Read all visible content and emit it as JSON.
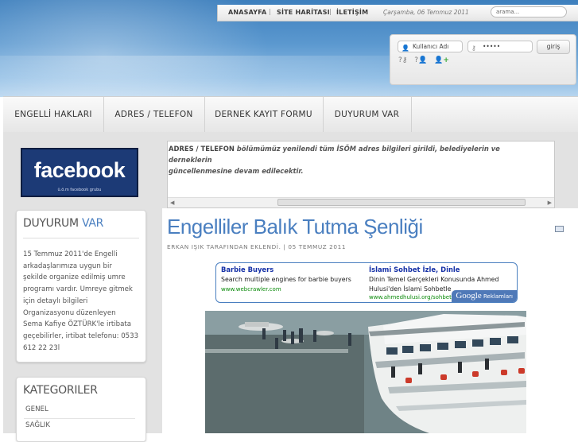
{
  "topbar": {
    "links": [
      "ANASAYFA",
      "SİTE HARİTASI",
      "İLETİŞİM"
    ],
    "separator": "|",
    "date": "Çarşamba, 06 Temmuz 2011",
    "search_placeholder": "arama..."
  },
  "login": {
    "username_placeholder": "Kullanıcı Adı",
    "password_value": "•••••",
    "button_label": "giriş"
  },
  "nav": {
    "items": [
      "ENGELLİ HAKLARI",
      "ADRES / TELEFON",
      "DERNEK KAYIT FORMU",
      "DUYURUM VAR"
    ]
  },
  "facebook": {
    "brand": "facebook",
    "caption": "ü.ö.m facebook grubu"
  },
  "sidebar": {
    "duyuru": {
      "title_a": "DUYURUM",
      "title_b": "VAR",
      "lines": [
        "15 Temmuz 2011'de Engelli",
        "arkadaşlarımıza uygun bir",
        "şekilde organize edilmiş umre",
        "programı vardır. Umreye gitmek",
        "için detaylı bilgileri",
        "Organizasyonu düzenleyen",
        "Sema Kafiye ÖZTÜRK'le irtibata",
        "geçebilirler, irtibat telefonu: 0533",
        "612 22 23l"
      ]
    },
    "kategoriler": {
      "title": "KATEGORILER",
      "items": [
        "GENEL",
        "SAĞLIK"
      ]
    }
  },
  "news": {
    "lead": "ADRES / TELEFON",
    "line1": " bölümümüz yenilendi tüm İSÖM adres bilgileri girildi, belediyelerin ve derneklerin",
    "line2": "güncellenmesine devam edilecektir."
  },
  "article": {
    "title": "Engelliler Balık Tutma Şenliği",
    "byline": "ERKAN IŞIK TARAFINDAN EKLENDİ. | 05 TEMMUZ 2011"
  },
  "ads": {
    "left": {
      "title": "Barbie Buyers",
      "desc": "Search multiple engines for barbie buyers",
      "url": "www.webcrawler.com"
    },
    "right": {
      "title": "İslami Sohbet İzle, Dinle",
      "desc1": "Dinin Temel Gerçekleri Konusunda Ahmed",
      "desc2": "Hulusi'den İslami Sohbetle",
      "url": "www.ahmedhulusi.org/sohbet"
    },
    "badge_brand": "Google",
    "badge_label": "Reklamları"
  },
  "colors": {
    "accent": "#4a7fc0",
    "facebook_blue": "#1c3a76",
    "ad_title": "#1530a6",
    "ad_url": "#0a8a0a"
  }
}
